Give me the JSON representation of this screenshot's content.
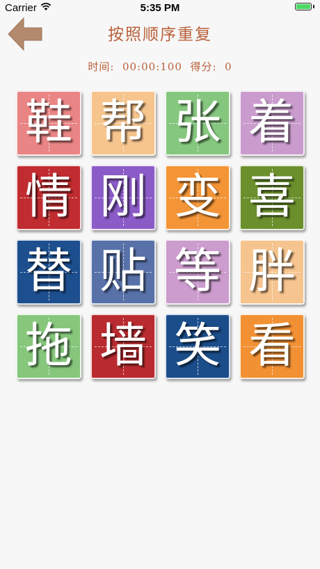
{
  "status_bar": {
    "carrier": "Carrier",
    "time": "5:35 PM"
  },
  "header": {
    "title": "按照顺序重复",
    "back_icon": "back-arrow-icon"
  },
  "info": {
    "time_label": "时间:",
    "time_value": "00:00:100",
    "score_label": "得分:",
    "score_value": "0"
  },
  "tiles": [
    {
      "char": "鞋",
      "color": "#ea8585"
    },
    {
      "char": "帮",
      "color": "#f6c48d"
    },
    {
      "char": "张",
      "color": "#86c77f"
    },
    {
      "char": "着",
      "color": "#c99ccd"
    },
    {
      "char": "情",
      "color": "#c02c30"
    },
    {
      "char": "刚",
      "color": "#8b5bc7"
    },
    {
      "char": "变",
      "color": "#f39436"
    },
    {
      "char": "喜",
      "color": "#6b8f2d"
    },
    {
      "char": "替",
      "color": "#1d4f8e"
    },
    {
      "char": "贴",
      "color": "#5872a9"
    },
    {
      "char": "等",
      "color": "#cb9ccd"
    },
    {
      "char": "胖",
      "color": "#f6c48f"
    },
    {
      "char": "拖",
      "color": "#86c77c"
    },
    {
      "char": "墙",
      "color": "#b92b30"
    },
    {
      "char": "笑",
      "color": "#1b4d8a"
    },
    {
      "char": "看",
      "color": "#f29134"
    }
  ]
}
